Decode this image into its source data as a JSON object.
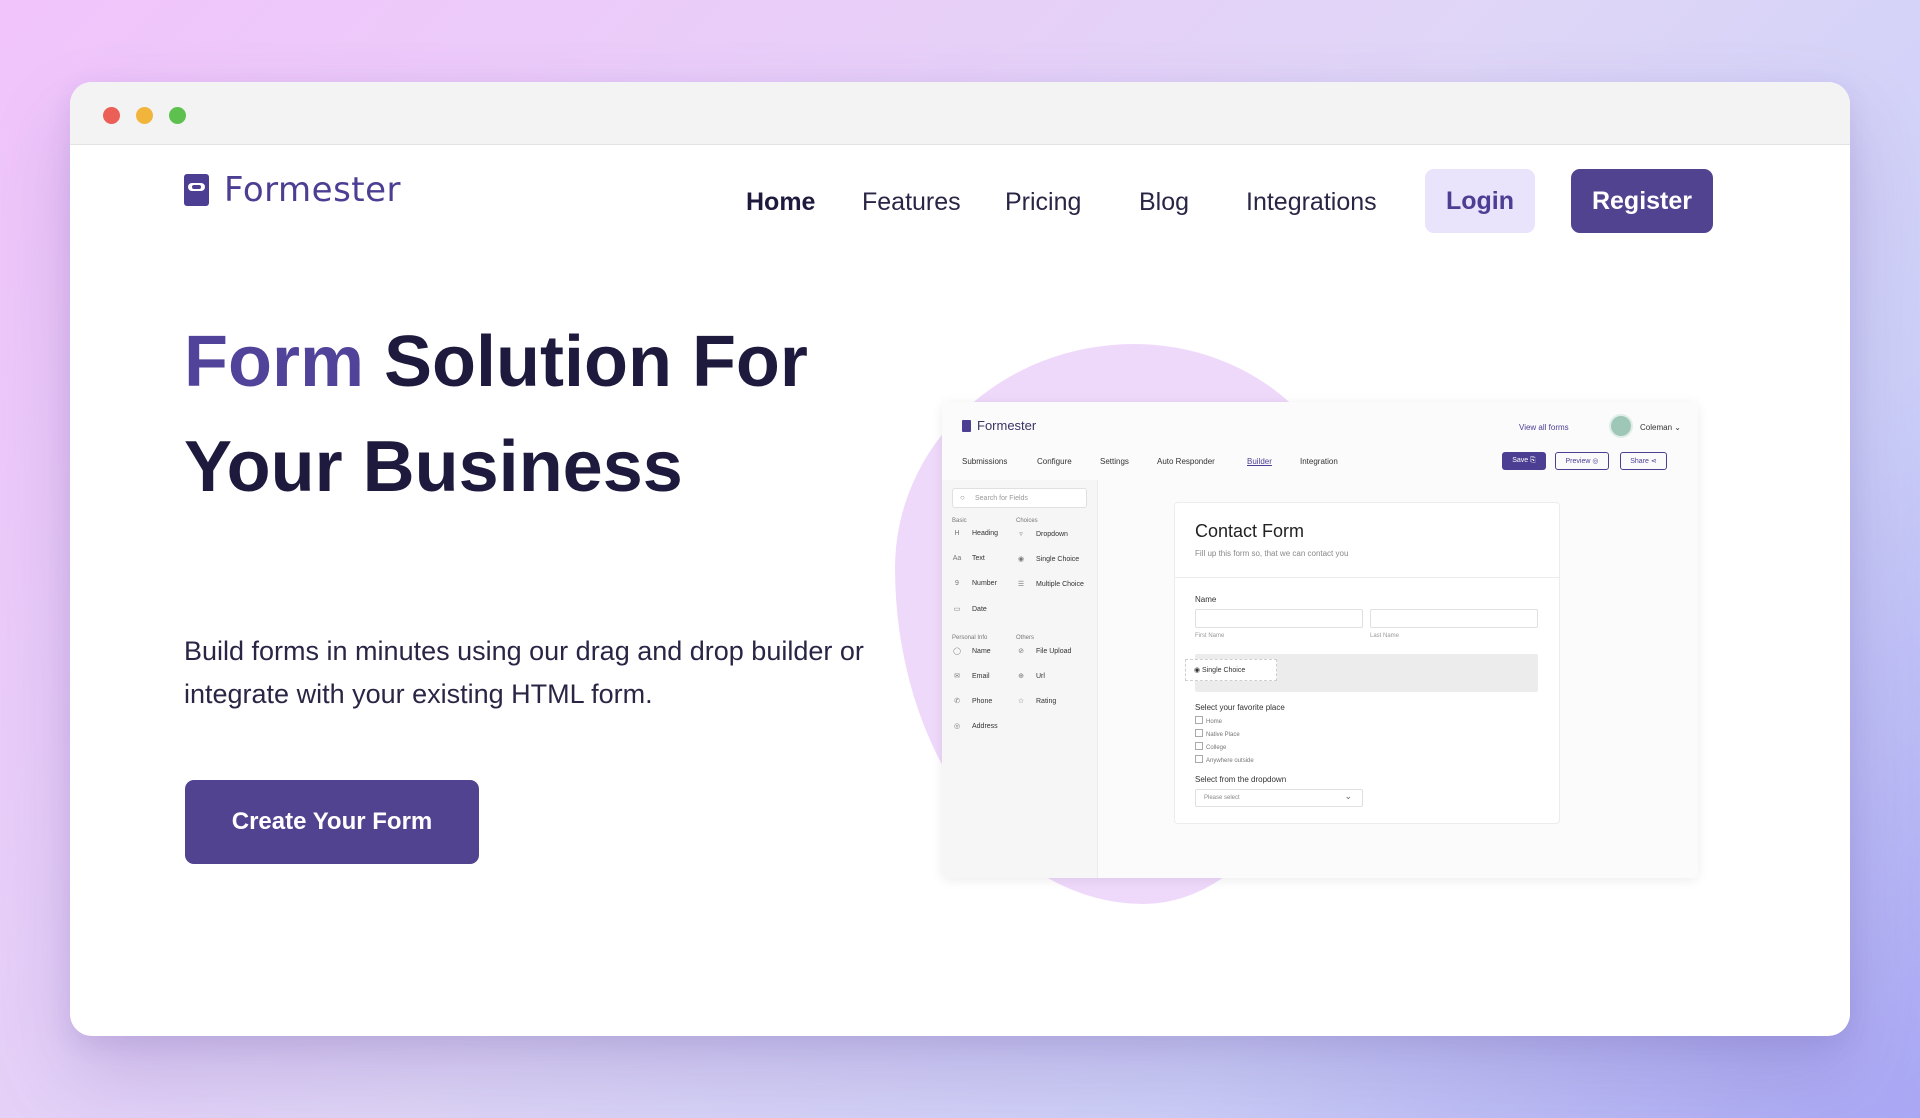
{
  "window": {
    "title": ""
  },
  "nav": {
    "logo_text": "Formester",
    "links": [
      {
        "label": "Home",
        "active": true
      },
      {
        "label": "Features",
        "active": false
      },
      {
        "label": "Pricing",
        "active": false
      },
      {
        "label": "Blog",
        "active": false
      },
      {
        "label": "Integrations",
        "active": false
      }
    ],
    "login_label": "Login",
    "register_label": "Register"
  },
  "hero": {
    "title_accent": "Form",
    "title_rest_line1": " Solution For",
    "title_line2": "Your Business",
    "subtitle": "Build forms in minutes using our drag and drop builder or integrate with your existing HTML form.",
    "cta_label": "Create Your Form"
  },
  "mockup": {
    "logo_text": "Formester",
    "view_all": "View all forms",
    "user_name": "Coleman ⌄",
    "tabs": [
      {
        "label": "Submissions"
      },
      {
        "label": "Configure"
      },
      {
        "label": "Settings"
      },
      {
        "label": "Auto Responder"
      },
      {
        "label": "Builder"
      },
      {
        "label": "Integration"
      }
    ],
    "save_label": "Save ⎘",
    "preview_label": "Preview ◎",
    "share_label": "Share ⋖",
    "search_placeholder": "Search for Fields",
    "groups": {
      "basic": "Basic",
      "choices": "Choices",
      "personal": "Personal Info",
      "others": "Others"
    },
    "fields": {
      "heading": {
        "label": "Heading",
        "icon": "H"
      },
      "text": {
        "label": "Text",
        "icon": "Aa"
      },
      "number": {
        "label": "Number",
        "icon": "9"
      },
      "date": {
        "label": "Date",
        "icon": "▭"
      },
      "dropdown": {
        "label": "Dropdown",
        "icon": "▿"
      },
      "single": {
        "label": "Single Choice",
        "icon": "◉"
      },
      "multiple": {
        "label": "Multiple Choice",
        "icon": "☰"
      },
      "name": {
        "label": "Name",
        "icon": "◯"
      },
      "email": {
        "label": "Email",
        "icon": "✉"
      },
      "phone": {
        "label": "Phone",
        "icon": "✆"
      },
      "address": {
        "label": "Address",
        "icon": "◎"
      },
      "file": {
        "label": "File Upload",
        "icon": "⊘"
      },
      "url": {
        "label": "Url",
        "icon": "⊕"
      },
      "rating": {
        "label": "Rating",
        "icon": "☆"
      }
    },
    "form": {
      "title": "Contact Form",
      "subtitle": "Fill up this form so, that we can contact you",
      "name_label": "Name",
      "first_name": "First Name",
      "last_name": "Last Name",
      "drag_item": "◉   Single Choice",
      "place_label": "Select your favorite place",
      "options": [
        "Home",
        "Native Place",
        "College",
        "Anywhere outside"
      ],
      "dropdown_label": "Select from the dropdown",
      "dropdown_placeholder": "Please select"
    }
  },
  "colors": {
    "brand": "#51438f",
    "login_bg": "#e9e3fb",
    "blob": "#efd9fb"
  }
}
